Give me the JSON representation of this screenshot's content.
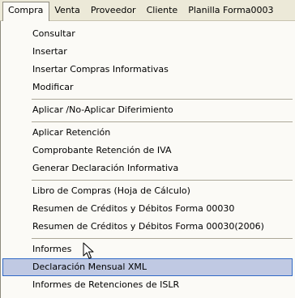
{
  "menubar": {
    "items": [
      "Compra",
      "Venta",
      "Proveedor",
      "Cliente",
      "Planilla Forma0003"
    ]
  },
  "menu": {
    "items": [
      "Consultar",
      "Insertar",
      "Insertar Compras Informativas",
      "Modificar",
      "Aplicar /No-Aplicar Diferimiento",
      "Aplicar Retención",
      "Comprobante Retención de IVA",
      "Generar Declaración Informativa",
      "Libro de Compras (Hoja de Cálculo)",
      "Resumen de Créditos y Débitos Forma 00030",
      "Resumen de Créditos y Débitos Forma 00030(2006)",
      "Informes",
      "Declaración Mensual XML",
      "Informes de Retenciones de ISLR"
    ],
    "selected": "Declaración Mensual XML"
  },
  "colors": {
    "menubar_bg": "#ece9d8",
    "menu_bg": "#fbfaf6",
    "highlight_bg": "#c0c9e3",
    "highlight_border": "#3169c6"
  }
}
